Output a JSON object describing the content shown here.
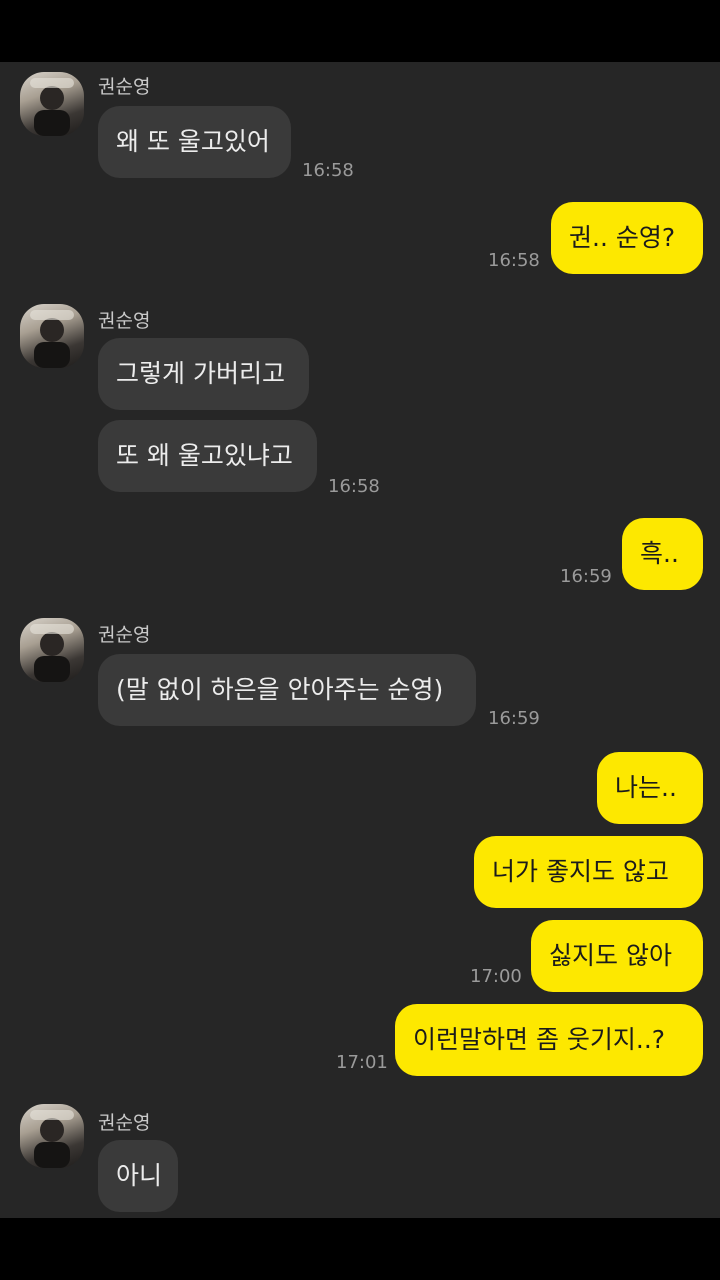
{
  "contact": {
    "name": "권순영"
  },
  "groups": [
    {
      "messages": [
        "왜 또 울고있어"
      ],
      "time": "16:58"
    },
    {
      "messages": [
        "권.. 순영?"
      ],
      "time": "16:58"
    },
    {
      "messages": [
        "그렇게 가버리고",
        "또 왜 울고있냐고"
      ],
      "time": "16:58"
    },
    {
      "messages": [
        "흑.."
      ],
      "time": "16:59"
    },
    {
      "messages": [
        "(말 없이 하은을 안아주는 순영)"
      ],
      "time": "16:59"
    },
    {
      "messages": [
        "나는..",
        "너가 좋지도 않고",
        "싫지도 않아"
      ],
      "time": "17:00"
    },
    {
      "messages": [
        "이런말하면 좀 웃기지..?"
      ],
      "time": "17:01"
    },
    {
      "messages": [
        "아니"
      ]
    }
  ],
  "colors": {
    "incoming": "#3a3a3a",
    "outgoing": "#fde800",
    "background": "#262626"
  }
}
